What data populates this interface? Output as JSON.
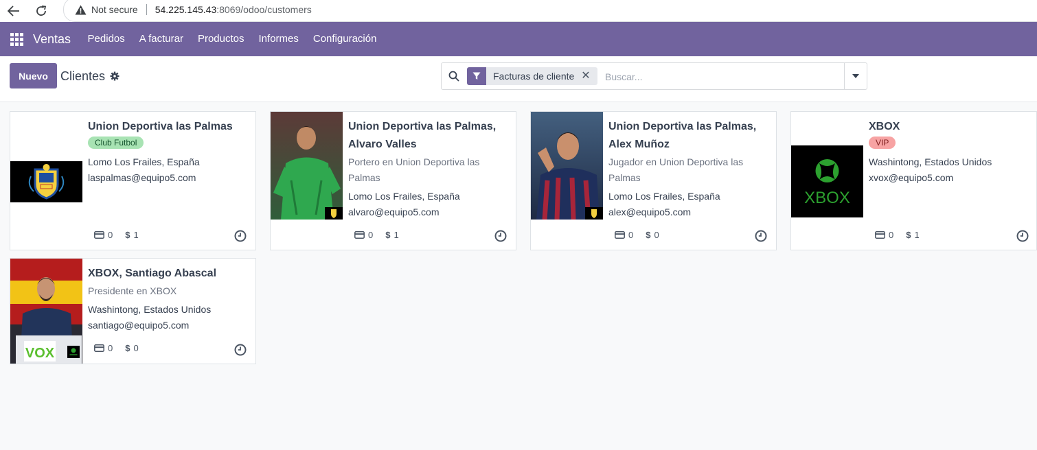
{
  "browser": {
    "security_label": "Not secure",
    "url_host": "54.225.145.43",
    "url_path": ":8069/odoo/customers"
  },
  "navbar": {
    "app_name": "Ventas",
    "menus": [
      "Pedidos",
      "A facturar",
      "Productos",
      "Informes",
      "Configuración"
    ],
    "color": "#71639e"
  },
  "control_panel": {
    "new_button": "Nuevo",
    "breadcrumb": "Clientes",
    "facet_label": "Facturas de cliente",
    "search_placeholder": "Buscar..."
  },
  "cards": [
    {
      "name": "Union Deportiva las Palmas",
      "tag": "Club Futbol",
      "address": "Lomo Los Frailes, España",
      "email": "laspalmas@equipo5.com",
      "invoices": "0",
      "sales": "1"
    },
    {
      "name": "Union Deportiva las Palmas, Alvaro Valles",
      "function": "Portero en Union Deportiva las Palmas",
      "address": "Lomo Los Frailes, España",
      "email": "alvaro@equipo5.com",
      "invoices": "0",
      "sales": "1"
    },
    {
      "name": "Union Deportiva las Palmas, Alex Muñoz",
      "function": "Jugador en Union Deportiva las Palmas",
      "address": "Lomo Los Frailes, España",
      "email": "alex@equipo5.com",
      "invoices": "0",
      "sales": "0"
    },
    {
      "name": "XBOX",
      "tag": "VIP",
      "address": "Washintong, Estados Unidos",
      "email": "xvox@equipo5.com",
      "invoices": "0",
      "sales": "1",
      "logo_text": "XBOX"
    },
    {
      "name": "XBOX, Santiago Abascal",
      "function": "Presidente en XBOX",
      "address": "Washintong, Estados Unidos",
      "email": "santiago@equipo5.com",
      "invoices": "0",
      "sales": "0",
      "banner_text": "VOX"
    }
  ]
}
